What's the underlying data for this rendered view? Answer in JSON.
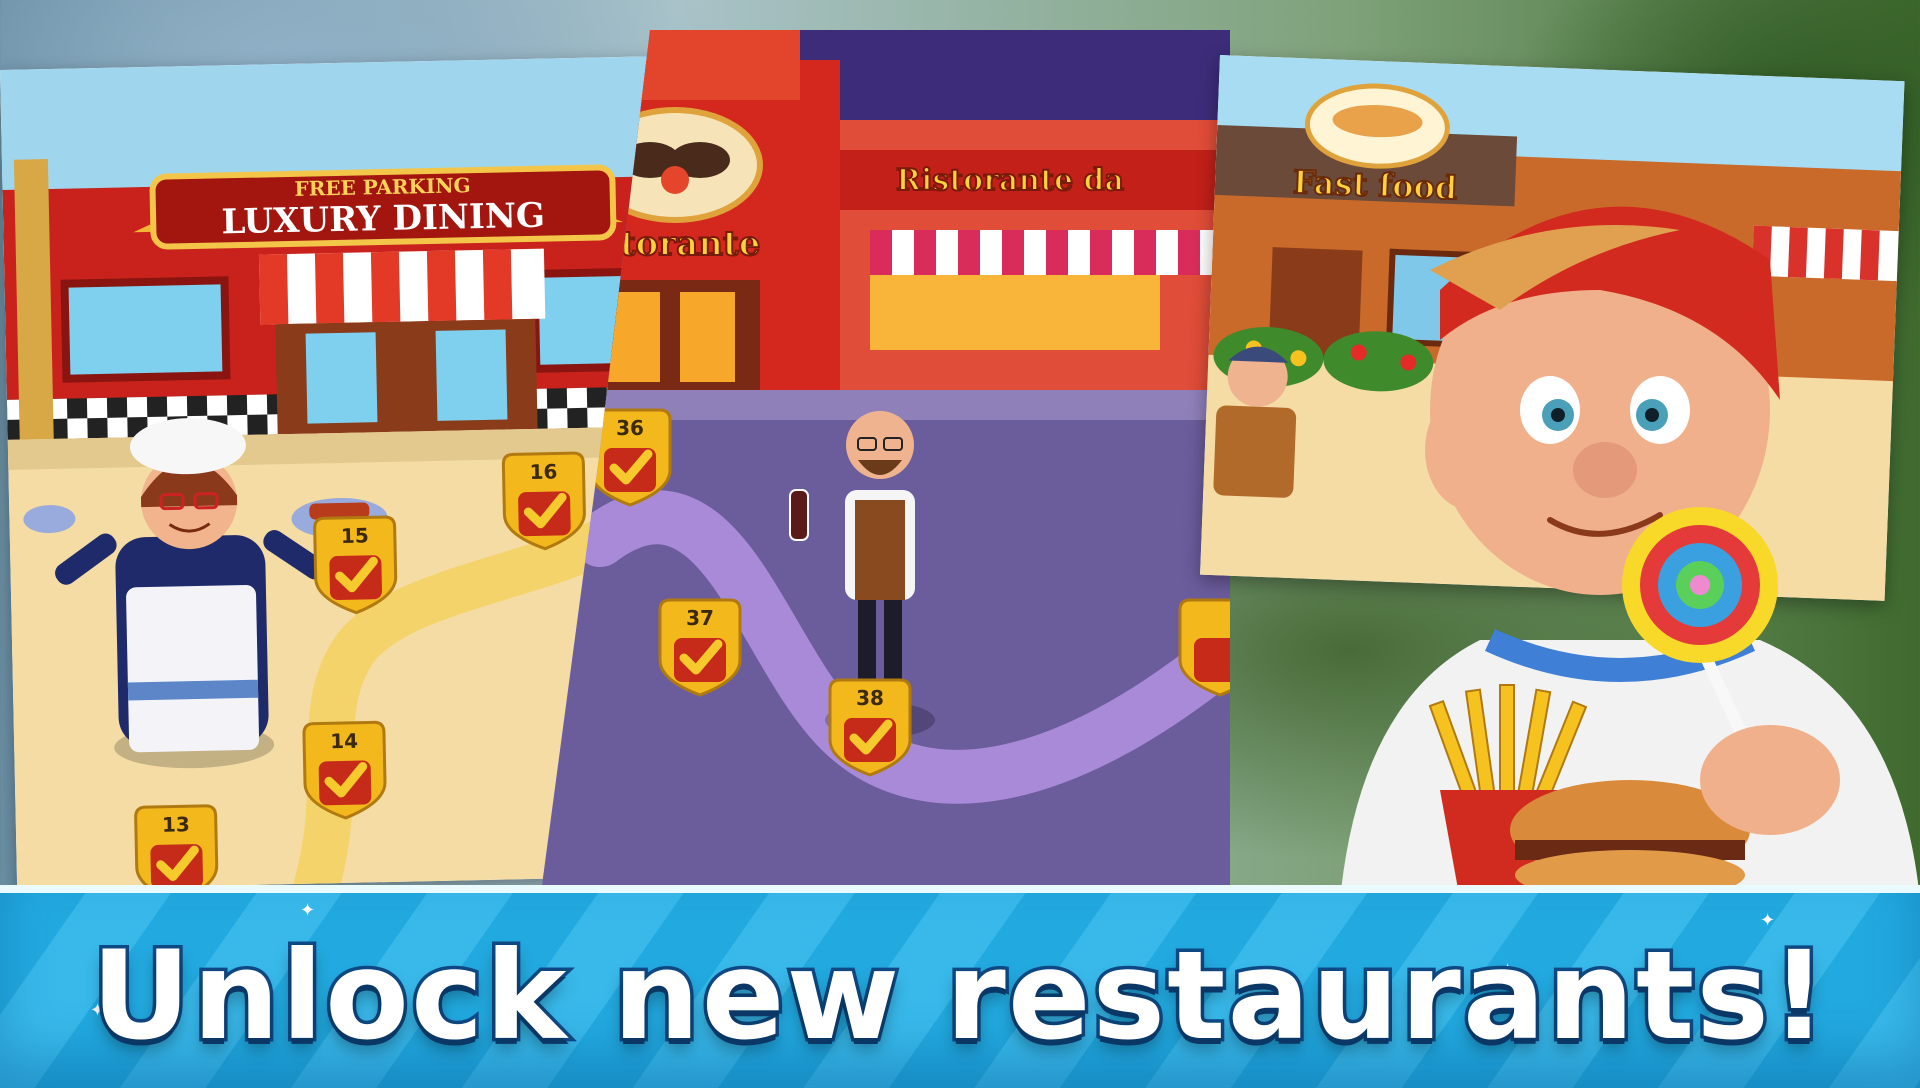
{
  "banner": {
    "title": "Unlock new restaurants!"
  },
  "panels": [
    {
      "name": "luxury-dining",
      "sign_small": "FREE PARKING",
      "sign_main": "LUXURY DINING",
      "levels": [
        "13",
        "14",
        "15",
        "16"
      ],
      "path_color": "#f5d36b"
    },
    {
      "name": "ristorante",
      "sign_main": "Ristorante",
      "sign_secondary": "Ristorante da",
      "levels": [
        "36",
        "37",
        "38"
      ],
      "path_color": "#a98ad9"
    },
    {
      "name": "fast-food",
      "sign_main": "Fast food"
    }
  ],
  "colors": {
    "banner_blue": "#22a9df",
    "banner_outline": "#0f4a86",
    "badge_gold": "#f2b81c",
    "badge_red": "#c62a18",
    "check_color": "#f6c92d"
  }
}
